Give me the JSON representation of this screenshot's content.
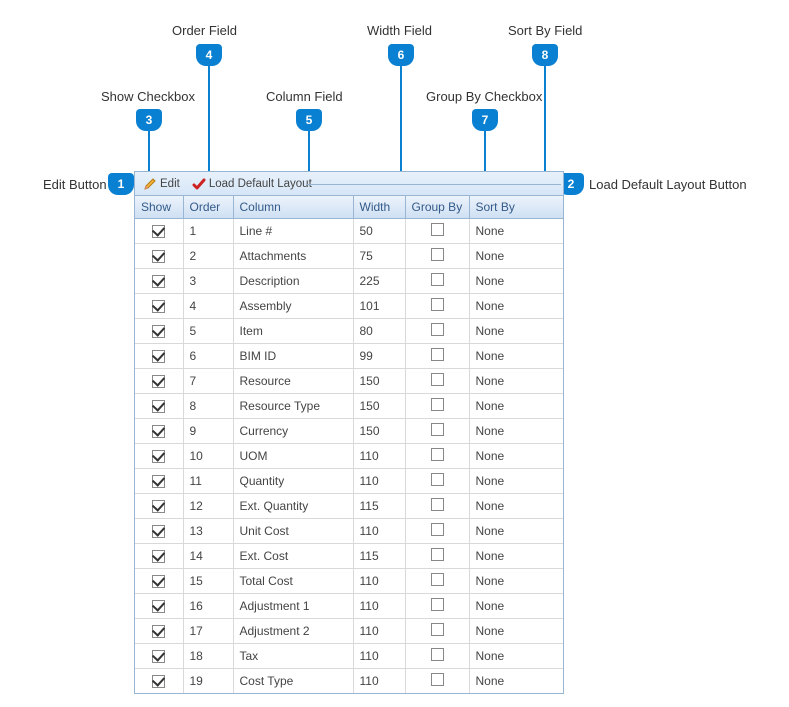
{
  "callouts": [
    {
      "n": 1,
      "label": "Edit Button"
    },
    {
      "n": 2,
      "label": "Load Default Layout Button"
    },
    {
      "n": 3,
      "label": "Show Checkbox"
    },
    {
      "n": 4,
      "label": "Order Field"
    },
    {
      "n": 5,
      "label": "Column Field"
    },
    {
      "n": 6,
      "label": "Width Field"
    },
    {
      "n": 7,
      "label": "Group By Checkbox"
    },
    {
      "n": 8,
      "label": "Sort By Field"
    }
  ],
  "toolbar": {
    "edit_label": "Edit",
    "load_default_label": "Load Default Layout"
  },
  "columns": {
    "show": "Show",
    "order": "Order",
    "column": "Column",
    "width": "Width",
    "group_by": "Group By",
    "sort_by": "Sort By"
  },
  "rows": [
    {
      "show": true,
      "order": "1",
      "column": "Line #",
      "width": "50",
      "group_by": false,
      "sort_by": "None"
    },
    {
      "show": true,
      "order": "2",
      "column": "Attachments",
      "width": "75",
      "group_by": false,
      "sort_by": "None"
    },
    {
      "show": true,
      "order": "3",
      "column": "Description",
      "width": "225",
      "group_by": false,
      "sort_by": "None"
    },
    {
      "show": true,
      "order": "4",
      "column": "Assembly",
      "width": "101",
      "group_by": false,
      "sort_by": "None"
    },
    {
      "show": true,
      "order": "5",
      "column": "Item",
      "width": "80",
      "group_by": false,
      "sort_by": "None"
    },
    {
      "show": true,
      "order": "6",
      "column": "BIM ID",
      "width": "99",
      "group_by": false,
      "sort_by": "None"
    },
    {
      "show": true,
      "order": "7",
      "column": "Resource",
      "width": "150",
      "group_by": false,
      "sort_by": "None"
    },
    {
      "show": true,
      "order": "8",
      "column": "Resource Type",
      "width": "150",
      "group_by": false,
      "sort_by": "None"
    },
    {
      "show": true,
      "order": "9",
      "column": "Currency",
      "width": "150",
      "group_by": false,
      "sort_by": "None"
    },
    {
      "show": true,
      "order": "10",
      "column": "UOM",
      "width": "110",
      "group_by": false,
      "sort_by": "None"
    },
    {
      "show": true,
      "order": "11",
      "column": "Quantity",
      "width": "110",
      "group_by": false,
      "sort_by": "None"
    },
    {
      "show": true,
      "order": "12",
      "column": "Ext. Quantity",
      "width": "115",
      "group_by": false,
      "sort_by": "None"
    },
    {
      "show": true,
      "order": "13",
      "column": "Unit Cost",
      "width": "110",
      "group_by": false,
      "sort_by": "None"
    },
    {
      "show": true,
      "order": "14",
      "column": "Ext. Cost",
      "width": "115",
      "group_by": false,
      "sort_by": "None"
    },
    {
      "show": true,
      "order": "15",
      "column": "Total Cost",
      "width": "110",
      "group_by": false,
      "sort_by": "None"
    },
    {
      "show": true,
      "order": "16",
      "column": "Adjustment 1",
      "width": "110",
      "group_by": false,
      "sort_by": "None"
    },
    {
      "show": true,
      "order": "17",
      "column": "Adjustment 2",
      "width": "110",
      "group_by": false,
      "sort_by": "None"
    },
    {
      "show": true,
      "order": "18",
      "column": "Tax",
      "width": "110",
      "group_by": false,
      "sort_by": "None"
    },
    {
      "show": true,
      "order": "19",
      "column": "Cost Type",
      "width": "110",
      "group_by": false,
      "sort_by": "None"
    }
  ]
}
